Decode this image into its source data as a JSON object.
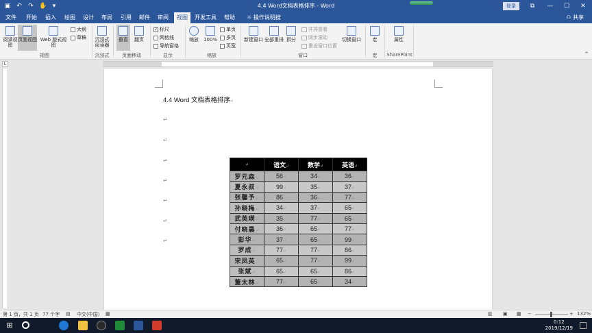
{
  "window": {
    "title": "4.4 Word文档表格排序 - Word",
    "login": "登录",
    "share": "共享",
    "controls": [
      "⧉",
      "—",
      "☐",
      "✕"
    ]
  },
  "tabs": [
    {
      "label": "文件"
    },
    {
      "label": "开始"
    },
    {
      "label": "插入"
    },
    {
      "label": "绘图"
    },
    {
      "label": "设计"
    },
    {
      "label": "布局"
    },
    {
      "label": "引用"
    },
    {
      "label": "邮件"
    },
    {
      "label": "审阅"
    },
    {
      "label": "视图"
    },
    {
      "label": "开发工具"
    },
    {
      "label": "帮助"
    },
    {
      "label": "操作说明搜索"
    }
  ],
  "ribbon": {
    "views": {
      "read": "阅读视图",
      "print": "页面视图",
      "web": "Web 版式视图",
      "outline": "大纲",
      "draft": "草稿",
      "group": "视图"
    },
    "immersive": {
      "reader": "沉浸式阅读器",
      "group": "沉浸式"
    },
    "movement": {
      "vertical": "垂直",
      "side": "翻页",
      "group": "页面移动"
    },
    "show": {
      "ruler": "标尺",
      "gridlines": "网格线",
      "nav": "导航窗格",
      "group": "显示"
    },
    "zoom": {
      "zoom": "缩放",
      "pct": "100%",
      "one": "单页",
      "multi": "多页",
      "width": "页宽",
      "group": "缩放"
    },
    "window": {
      "new": "新建窗口",
      "arrange": "全部重排",
      "split": "拆分",
      "side_by_side": "并排查看",
      "sync": "同步滚动",
      "reset": "重设窗口位置",
      "switch": "切换窗口",
      "group": "窗口"
    },
    "macros": {
      "macros": "宏",
      "group": "宏"
    },
    "sharepoint": {
      "props": "属性",
      "group": "SharePoint"
    }
  },
  "document": {
    "title": "4.4 Word 文档表格排序",
    "para_mark": "↵",
    "cell_mark": "↵",
    "table": {
      "headers": [
        "",
        "语文",
        "数学",
        "英语"
      ],
      "rows": [
        [
          "罗元森",
          "56",
          "34",
          "36"
        ],
        [
          "夏永叔",
          "99",
          "35",
          "37"
        ],
        [
          "张馨予",
          "86",
          "36",
          "77"
        ],
        [
          "孙晓梅",
          "34",
          "37",
          "65"
        ],
        [
          "武英瑛",
          "35",
          "77",
          "65"
        ],
        [
          "付晓晨",
          "36",
          "65",
          "77"
        ],
        [
          "彭华",
          "37",
          "65",
          "99"
        ],
        [
          "罗成",
          "77",
          "77",
          "86"
        ],
        [
          "宋凤英",
          "65",
          "77",
          "99"
        ],
        [
          "张斌",
          "65",
          "65",
          "86"
        ],
        [
          "董太林",
          "77",
          "65",
          "34"
        ]
      ]
    }
  },
  "status": {
    "page": "第 1 页，共 1 页",
    "words": "77 个字",
    "lang": "中文(中国)",
    "zoom": "132%",
    "zoom_minus": "−",
    "zoom_plus": "+"
  },
  "taskbar": {
    "time": "0:12",
    "date": "2019/12/19"
  },
  "colors": {
    "accent": "#2b579a",
    "taskbar": "#101a2b"
  }
}
